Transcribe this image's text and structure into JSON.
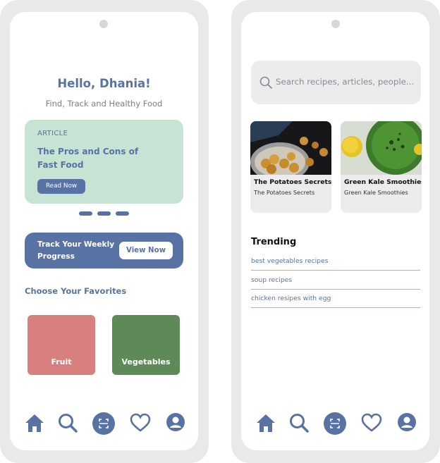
{
  "colors": {
    "accent": "#5873a3",
    "article_bg": "#c6e3d4",
    "fruit": "#d87f80",
    "vegetables": "#5e8a58",
    "bezel": "#e9e9ec"
  },
  "left": {
    "greeting": "Hello, Dhania!",
    "subtitle": "Find, Track and Healthy Food",
    "article": {
      "tag": "ARTICLE",
      "title": "The Pros and Cons of Fast Food",
      "button": "Read Now"
    },
    "track": {
      "text": "Track Your Weekly Progress",
      "button": "View Now"
    },
    "section_title": "Choose Your Favorites",
    "categories": [
      {
        "label": "Fruit"
      },
      {
        "label": "Vegetables"
      }
    ]
  },
  "right": {
    "search_placeholder": "Search recipes, articles, people...",
    "cards": [
      {
        "title": "The Potatoes Secrets",
        "subtitle": "The Potatoes Secrets"
      },
      {
        "title": "Green Kale Smoothies",
        "subtitle": "Green Kale Smoothies"
      }
    ],
    "trending_title": "Trending",
    "trending_items": [
      "best vegetables recipes",
      "soup recipes",
      "chicken resipes with egg"
    ]
  },
  "nav_icons": [
    "home-icon",
    "search-icon",
    "scan-icon",
    "heart-icon",
    "profile-icon"
  ]
}
